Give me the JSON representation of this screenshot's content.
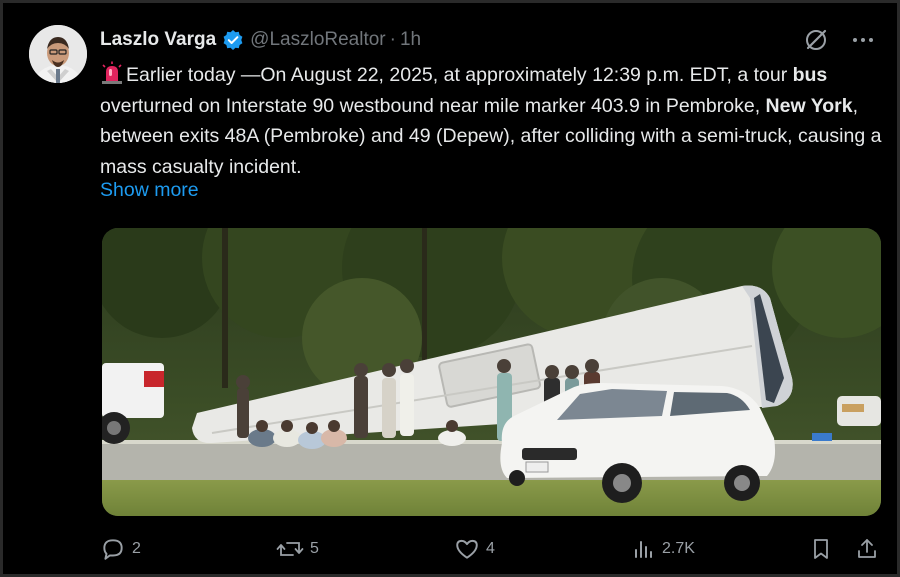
{
  "author": {
    "name": "Laszlo Varga",
    "handle": "@LaszloRealtor",
    "separator": "·",
    "time": "1h"
  },
  "tweet": {
    "line_prefix": "Earlier today —On August 22, 2025, at approximately 12:39 p.m. EDT, a tour ",
    "bold_1": "bus",
    "mid_1": " overturned on Interstate 90 westbound near mile marker 403.9 in Pembroke, ",
    "bold_2": "New York",
    "suffix": ", between exits 48A (Pembroke) and 49 (Depew), after colliding with a semi-truck, causing a mass casualty incident.",
    "show_more": "Show more"
  },
  "icons": {
    "siren": "police-light-emoji",
    "verified": "verified-badge-icon",
    "grok": "grok-icon",
    "more": "more-icon"
  },
  "actions": {
    "replies": "2",
    "reposts": "5",
    "likes": "4",
    "views": "2.7K"
  },
  "colors": {
    "background": "#000000",
    "text": "#e7e9ea",
    "muted": "#71767b",
    "accent": "#1d9bf0"
  }
}
